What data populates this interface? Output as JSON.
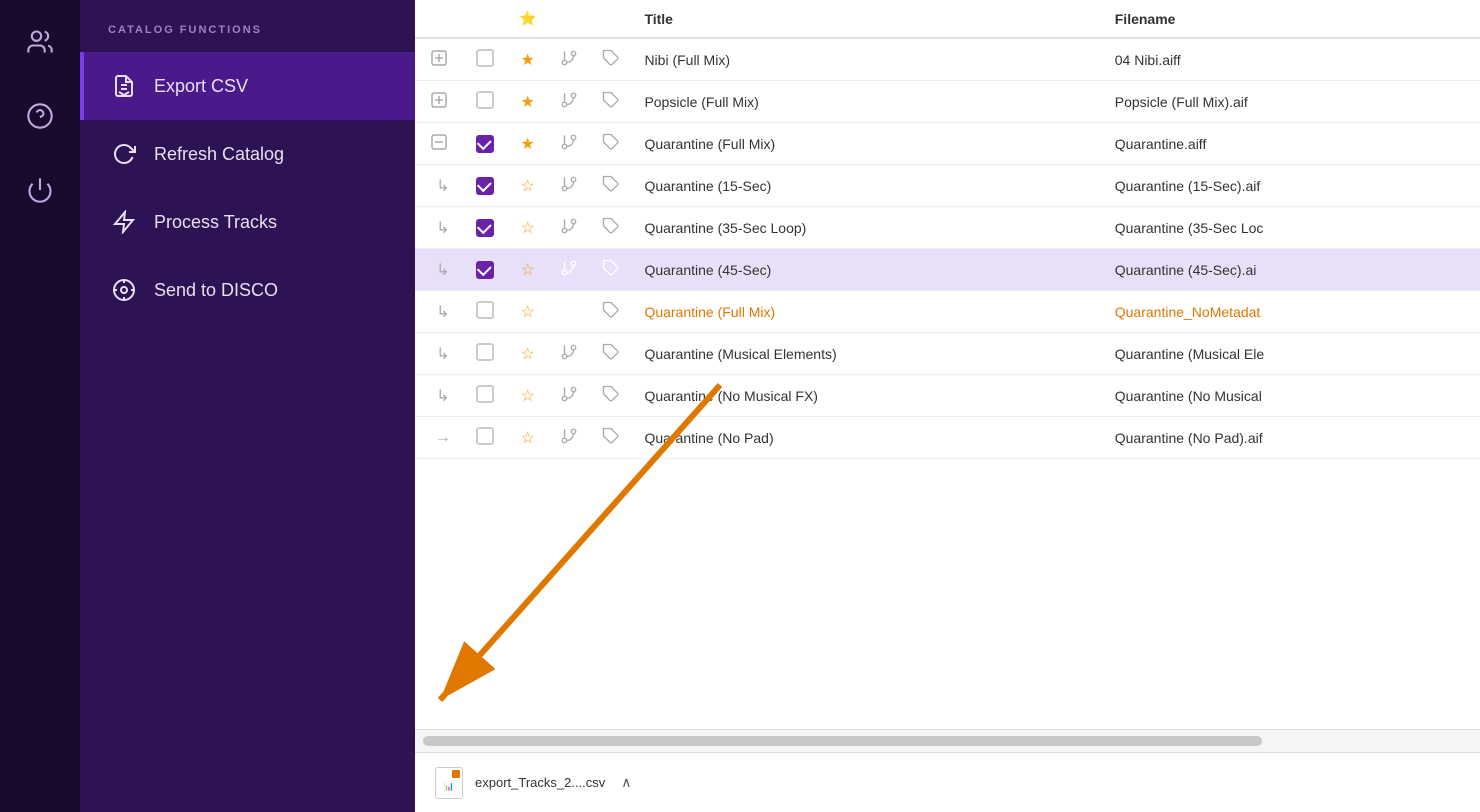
{
  "sidebar": {
    "title": "CATALOG FUNCTIONS",
    "icons": [
      {
        "name": "users-icon",
        "label": "Users"
      },
      {
        "name": "help-icon",
        "label": "Help"
      },
      {
        "name": "power-icon",
        "label": "Power"
      }
    ],
    "menu_items": [
      {
        "id": "export-csv",
        "label": "Export CSV",
        "active": true,
        "icon": "export-icon"
      },
      {
        "id": "refresh-catalog",
        "label": "Refresh Catalog",
        "active": false,
        "icon": "refresh-icon"
      },
      {
        "id": "process-tracks",
        "label": "Process Tracks",
        "active": false,
        "icon": "process-icon"
      },
      {
        "id": "send-to-disco",
        "label": "Send to DISCO",
        "active": false,
        "icon": "disco-icon"
      }
    ]
  },
  "table": {
    "columns": [
      "expand",
      "check",
      "star",
      "branch",
      "tag",
      "title",
      "filename"
    ],
    "rows": [
      {
        "id": 1,
        "expand": "plus",
        "checked": false,
        "starred": true,
        "has_branch": true,
        "has_tag": true,
        "title": "Nibi (Full Mix)",
        "filename": "04 Nibi.aiff",
        "selected": false,
        "indent": false,
        "warning": false
      },
      {
        "id": 2,
        "expand": "plus",
        "checked": false,
        "starred": true,
        "has_branch": true,
        "has_tag": true,
        "title": "Popsicle (Full Mix)",
        "filename": "Popsicle (Full Mix).aif",
        "selected": false,
        "indent": false,
        "warning": false
      },
      {
        "id": 3,
        "expand": "minus",
        "checked": true,
        "starred": true,
        "has_branch": true,
        "has_tag": true,
        "title": "Quarantine (Full Mix)",
        "filename": "Quarantine.aiff",
        "selected": false,
        "indent": false,
        "warning": false
      },
      {
        "id": 4,
        "expand": "indent",
        "checked": true,
        "starred": false,
        "has_branch": true,
        "has_tag": true,
        "title": "Quarantine (15-Sec)",
        "filename": "Quarantine (15-Sec).aif",
        "selected": false,
        "indent": true,
        "warning": false
      },
      {
        "id": 5,
        "expand": "indent",
        "checked": true,
        "starred": false,
        "has_branch": true,
        "has_tag": true,
        "title": "Quarantine (35-Sec Loop)",
        "filename": "Quarantine (35-Sec Loc",
        "selected": false,
        "indent": true,
        "warning": false
      },
      {
        "id": 6,
        "expand": "indent",
        "checked": true,
        "starred": false,
        "has_branch": true,
        "has_tag": true,
        "title": "Quarantine (45-Sec)",
        "filename": "Quarantine (45-Sec).ai",
        "selected": true,
        "indent": true,
        "warning": false
      },
      {
        "id": 7,
        "expand": "indent",
        "checked": false,
        "starred": false,
        "has_branch": false,
        "has_tag": true,
        "title": "Quarantine (Full Mix)",
        "filename": "Quarantine_NoMetadat",
        "selected": false,
        "indent": true,
        "warning": true
      },
      {
        "id": 8,
        "expand": "indent",
        "checked": false,
        "starred": false,
        "has_branch": true,
        "has_tag": true,
        "title": "Quarantine (Musical Elements)",
        "filename": "Quarantine (Musical Ele",
        "selected": false,
        "indent": true,
        "warning": false
      },
      {
        "id": 9,
        "expand": "indent",
        "checked": false,
        "starred": false,
        "has_branch": true,
        "has_tag": true,
        "title": "Quarantine (No Musical FX)",
        "filename": "Quarantine (No Musical",
        "selected": false,
        "indent": true,
        "warning": false
      },
      {
        "id": 10,
        "expand": "arrow",
        "checked": false,
        "starred": false,
        "has_branch": true,
        "has_tag": true,
        "title": "Quarantine (No Pad)",
        "filename": "Quarantine (No Pad).aif",
        "selected": false,
        "indent": false,
        "warning": false
      }
    ]
  },
  "download_bar": {
    "filename": "export_Tracks_2....csv",
    "icon": "csv-file-icon"
  }
}
